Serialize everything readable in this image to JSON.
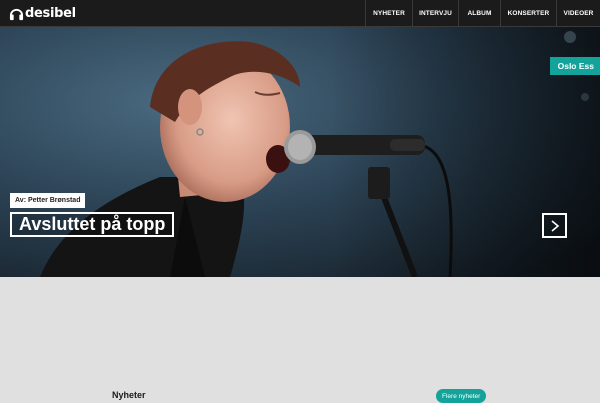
{
  "header": {
    "logo_text": "desibel",
    "nav": [
      "NYHETER",
      "INTERVJU",
      "ALBUM",
      "KONSERTER",
      "VIDEOER"
    ]
  },
  "hero": {
    "tag": "Oslo Ess",
    "byline": "Av: Petter Brønstad",
    "headline": "Avsluttet på topp"
  },
  "news": {
    "title": "Nyheter",
    "more_label": "Flere nyheter"
  },
  "colors": {
    "accent": "#14a39a",
    "topbar": "#1b1b1b",
    "page_background": "#e0e0e0"
  },
  "icons": {
    "logo": "headphones-logo-icon",
    "next": "chevron-right-icon"
  }
}
